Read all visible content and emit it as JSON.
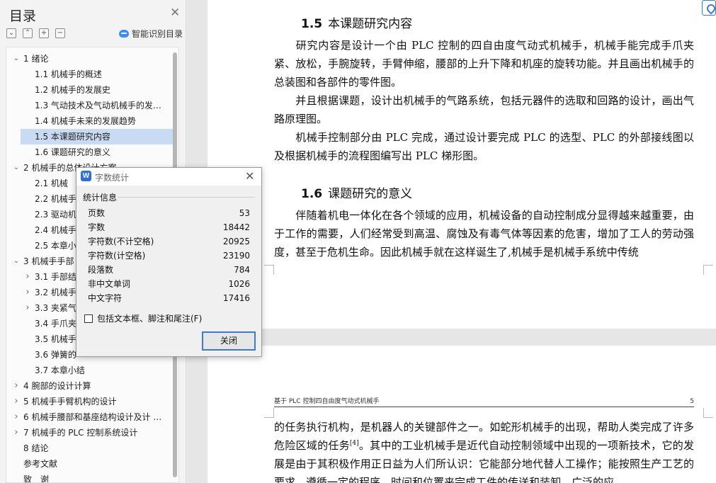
{
  "toc": {
    "title": "目录",
    "smart_label": "智能识别目录",
    "tools": [
      "collapse-all",
      "expand-up",
      "add",
      "remove"
    ],
    "items": [
      {
        "label": "1  绪论",
        "level": 1,
        "expanded": true
      },
      {
        "label": "1.1  机械手的概述",
        "level": 2
      },
      {
        "label": "1.2  机械手的发展史",
        "level": 2
      },
      {
        "label": "1.3  气动技术及气动机械手的发…",
        "level": 2
      },
      {
        "label": "1.4  机械手未来的发展趋势",
        "level": 2
      },
      {
        "label": "1.5  本课题研究内容",
        "level": 2,
        "selected": true
      },
      {
        "label": "1.6  课题研究的意义",
        "level": 2
      },
      {
        "label": "2  机械手的总体设计方案",
        "level": 1,
        "expanded": true
      },
      {
        "label": "2.1  机械",
        "level": 2
      },
      {
        "label": "2.2  机械手",
        "level": 2
      },
      {
        "label": "2.3  驱动机",
        "level": 2
      },
      {
        "label": "2.4  机械手",
        "level": 2
      },
      {
        "label": "2.5  本章小",
        "level": 2
      },
      {
        "label": "3  机械手手部",
        "level": 1,
        "expanded": true
      },
      {
        "label": "3.1  手部结",
        "level": 2,
        "collapsed": true
      },
      {
        "label": "3.2  机械手",
        "level": 2,
        "collapsed": true
      },
      {
        "label": "3.3  夹紧气",
        "level": 2,
        "collapsed": true
      },
      {
        "label": "3.4  手爪夹",
        "level": 2
      },
      {
        "label": "3.5  机械手",
        "level": 2
      },
      {
        "label": "3.6  弹簧的",
        "level": 2
      },
      {
        "label": "3.7  本章小结",
        "level": 2
      },
      {
        "label": "4  腕部的设计计算",
        "level": 1,
        "collapsed": true
      },
      {
        "label": "5  机械手手臂机构的设计",
        "level": 1,
        "collapsed": true
      },
      {
        "label": "6  机械手腰部和基座结构设计及计 …",
        "level": 1,
        "collapsed": true
      },
      {
        "label": "7  机械手的 PLC 控制系统设计",
        "level": 1,
        "collapsed": true
      },
      {
        "label": "8  结论",
        "level": 1
      },
      {
        "label": "参考文献",
        "level": 0
      },
      {
        "label": "致　谢",
        "level": 0
      }
    ]
  },
  "document": {
    "sections": [
      {
        "num": "1.5",
        "title": "本课题研究内容"
      },
      {
        "num": "1.6",
        "title": "课题研究的意义"
      }
    ],
    "page1_paras": [
      "研究内容是设计一个由 PLC 控制的四自由度气动式机械手，机械手能完成手爪夹紧、放松，手腕旋转，手臂伸缩，腰部的上升下降和机座的旋转功能。并且画出机械手的总装图和各部件的零件图。",
      "并且根据课题，设计出机械手的气路系统，包括元器件的选取和回路的设计，画出气路原理图。",
      "机械手控制部分由 PLC 完成，通过设计要完成 PLC 的选型、PLC 的外部接线图以及根据机械手的流程图编写出 PLC 梯形图。",
      "伴随着机电一体化在各个领域的应用，机械设备的自动控制成分显得越来越重要，由于工作的需要，人们经常受到高温、腐蚀及有毒气体等因素的危害，增加了工人的劳动强度，甚至于危机生命。因此机械手就在这样诞生了,机械手是机械手系统中传统"
    ],
    "running_head": "基于 PLC 控制四自由度气动式机械手",
    "page_number": "5",
    "page2_text_a": "的任务执行机构，是机器人的关键部件之一。如蛇形机械手的出现，帮助人类完成了许多危险区域的任务",
    "page2_ref": "[4]",
    "page2_text_b": "。其中的工业机械手是近代自动控制领域中出现的一项新技术，它的发展是由于其积极作用正日益为人们所认识：它能部分地代替人工操作；能按照生产工艺的要求，遵循一定的程序、时间和位置来完成工件的传送和装卸，广泛的应"
  },
  "dialog": {
    "title": "字数统计",
    "section": "统计信息",
    "stats": [
      {
        "label": "页数",
        "value": "53"
      },
      {
        "label": "字数",
        "value": "18442"
      },
      {
        "label": "字符数(不计空格)",
        "value": "20925"
      },
      {
        "label": "字符数(计空格)",
        "value": "23190"
      },
      {
        "label": "段落数",
        "value": "784"
      },
      {
        "label": "非中文单词",
        "value": "1026"
      },
      {
        "label": "中文字符",
        "value": "17416"
      }
    ],
    "checkbox_label": "包括文本框、脚注和尾注(F)",
    "checkbox_checked": false,
    "close_label": "关闭"
  },
  "colors": {
    "selection": "#c9daf3",
    "accent": "#3a7bd5"
  }
}
